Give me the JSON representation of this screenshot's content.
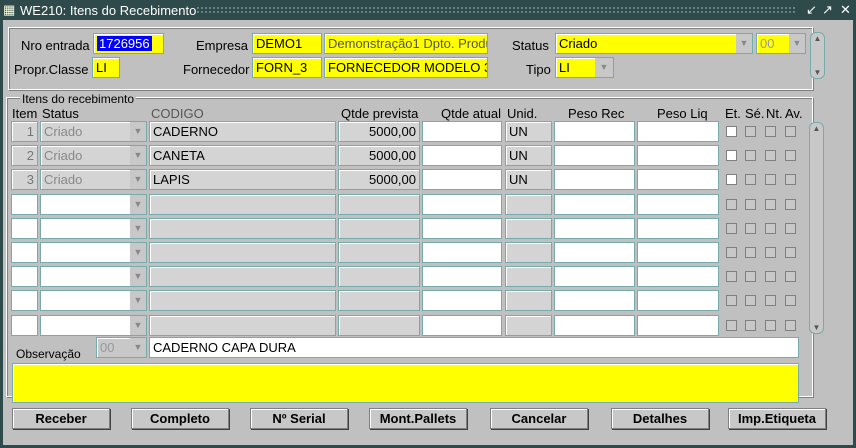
{
  "window": {
    "title": "WE210: Itens do Recebimento"
  },
  "header": {
    "nro_entrada_label": "Nro entrada",
    "nro_entrada": "1726956",
    "empresa_label": "Empresa",
    "empresa_code": "DEMO1",
    "empresa_desc": "Demonstração1 Dpto. Produ",
    "status_label": "Status",
    "status": "Criado",
    "status_code": "00",
    "propr_classe_label": "Propr.Classe",
    "propr_classe": "LI",
    "fornecedor_label": "Fornecedor",
    "fornecedor_code": "FORN_3",
    "fornecedor_desc": "FORNECEDOR MODELO 3",
    "tipo_label": "Tipo",
    "tipo": "LI"
  },
  "items": {
    "frame_title": "Itens do recebimento",
    "columns": {
      "item": "Item",
      "status": "Status",
      "codigo": "CODIGO",
      "qtde_prevista": "Qtde prevista",
      "qtde_atual": "Qtde atual",
      "unid": "Unid.",
      "peso_rec": "Peso Rec",
      "peso_liq": "Peso Liq",
      "et": "Et.",
      "se": "Sé.",
      "nt": "Nt.",
      "av": "Av."
    },
    "rows": [
      {
        "item": "1",
        "status": "Criado",
        "codigo": "CADERNO",
        "qtde_prevista": "5000,00",
        "qtde_atual": "",
        "unid": "UN",
        "peso_rec": "",
        "peso_liq": ""
      },
      {
        "item": "2",
        "status": "Criado",
        "codigo": "CANETA",
        "qtde_prevista": "5000,00",
        "qtde_atual": "",
        "unid": "UN",
        "peso_rec": "",
        "peso_liq": ""
      },
      {
        "item": "3",
        "status": "Criado",
        "codigo": "LAPIS",
        "qtde_prevista": "5000,00",
        "qtde_atual": "",
        "unid": "UN",
        "peso_rec": "",
        "peso_liq": ""
      },
      {},
      {},
      {},
      {},
      {},
      {}
    ]
  },
  "observacao": {
    "label": "Observação",
    "code": "00",
    "text": "CADERNO CAPA DURA",
    "notes": ""
  },
  "buttons": [
    "Receber",
    "Completo",
    "Nº Serial",
    "Mont.Pallets",
    "Cancelar",
    "Detalhes",
    "Imp.Etiqueta"
  ]
}
